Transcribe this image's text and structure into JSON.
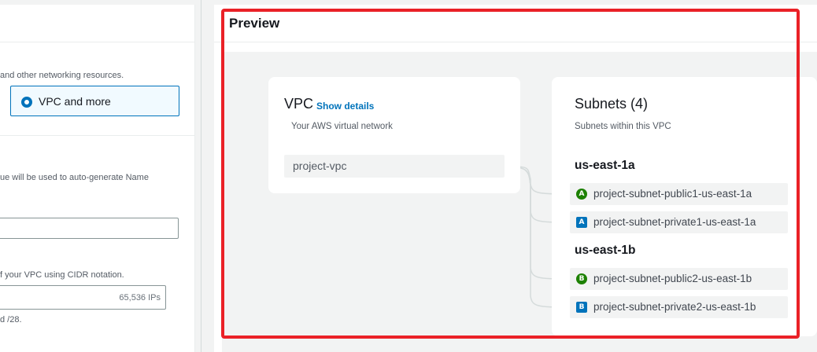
{
  "left_panel": {
    "resources_text": "and other networking resources.",
    "radio_option": {
      "label": "VPC and more",
      "selected": true
    },
    "name_help_text": "ue will be used to auto-generate Name",
    "cidr_help_text": "f your VPC using CIDR notation.",
    "cidr_ips": "65,536 IPs",
    "cidr_hint": "d /28."
  },
  "preview": {
    "title": "Preview",
    "vpc": {
      "heading": "VPC",
      "link": "Show details",
      "subtitle": "Your AWS virtual network",
      "item": "project-vpc"
    },
    "subnets": {
      "heading": "Subnets (4)",
      "subtitle": "Subnets within this VPC",
      "zones": [
        {
          "name": "us-east-1a",
          "subnets": [
            {
              "badge": "A",
              "kind": "public",
              "name": "project-subnet-public1-us-east-1a"
            },
            {
              "badge": "A",
              "kind": "private",
              "name": "project-subnet-private1-us-east-1a"
            }
          ]
        },
        {
          "name": "us-east-1b",
          "subnets": [
            {
              "badge": "B",
              "kind": "public",
              "name": "project-subnet-public2-us-east-1b"
            },
            {
              "badge": "B",
              "kind": "private",
              "name": "project-subnet-private2-us-east-1b"
            }
          ]
        }
      ]
    }
  },
  "colors": {
    "accent": "#0073bb",
    "public_badge": "#1d8102",
    "private_badge": "#0073bb",
    "highlight": "#ea2127"
  }
}
